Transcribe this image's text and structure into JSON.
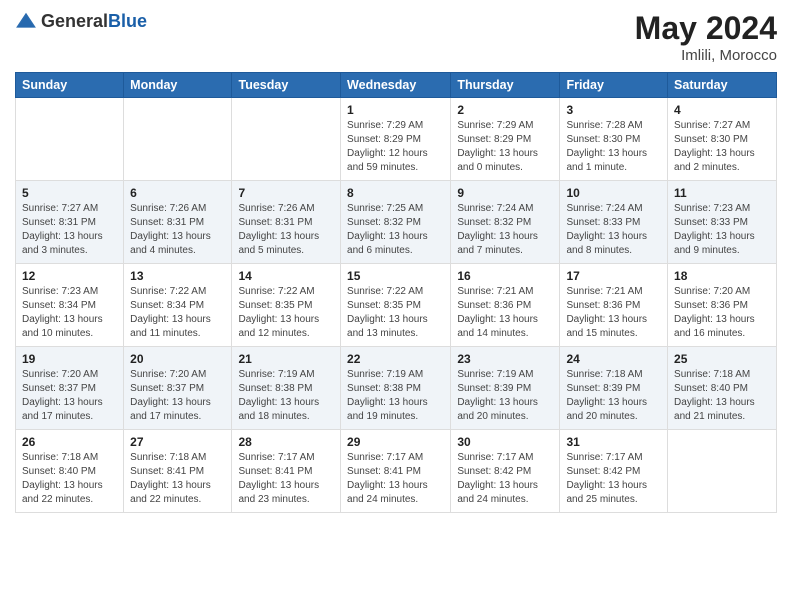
{
  "header": {
    "logo_general": "General",
    "logo_blue": "Blue",
    "month_year": "May 2024",
    "location": "Imlili, Morocco"
  },
  "days_of_week": [
    "Sunday",
    "Monday",
    "Tuesday",
    "Wednesday",
    "Thursday",
    "Friday",
    "Saturday"
  ],
  "weeks": [
    [
      {
        "day": "",
        "info": ""
      },
      {
        "day": "",
        "info": ""
      },
      {
        "day": "",
        "info": ""
      },
      {
        "day": "1",
        "info": "Sunrise: 7:29 AM\nSunset: 8:29 PM\nDaylight: 12 hours\nand 59 minutes."
      },
      {
        "day": "2",
        "info": "Sunrise: 7:29 AM\nSunset: 8:29 PM\nDaylight: 13 hours\nand 0 minutes."
      },
      {
        "day": "3",
        "info": "Sunrise: 7:28 AM\nSunset: 8:30 PM\nDaylight: 13 hours\nand 1 minute."
      },
      {
        "day": "4",
        "info": "Sunrise: 7:27 AM\nSunset: 8:30 PM\nDaylight: 13 hours\nand 2 minutes."
      }
    ],
    [
      {
        "day": "5",
        "info": "Sunrise: 7:27 AM\nSunset: 8:31 PM\nDaylight: 13 hours\nand 3 minutes."
      },
      {
        "day": "6",
        "info": "Sunrise: 7:26 AM\nSunset: 8:31 PM\nDaylight: 13 hours\nand 4 minutes."
      },
      {
        "day": "7",
        "info": "Sunrise: 7:26 AM\nSunset: 8:31 PM\nDaylight: 13 hours\nand 5 minutes."
      },
      {
        "day": "8",
        "info": "Sunrise: 7:25 AM\nSunset: 8:32 PM\nDaylight: 13 hours\nand 6 minutes."
      },
      {
        "day": "9",
        "info": "Sunrise: 7:24 AM\nSunset: 8:32 PM\nDaylight: 13 hours\nand 7 minutes."
      },
      {
        "day": "10",
        "info": "Sunrise: 7:24 AM\nSunset: 8:33 PM\nDaylight: 13 hours\nand 8 minutes."
      },
      {
        "day": "11",
        "info": "Sunrise: 7:23 AM\nSunset: 8:33 PM\nDaylight: 13 hours\nand 9 minutes."
      }
    ],
    [
      {
        "day": "12",
        "info": "Sunrise: 7:23 AM\nSunset: 8:34 PM\nDaylight: 13 hours\nand 10 minutes."
      },
      {
        "day": "13",
        "info": "Sunrise: 7:22 AM\nSunset: 8:34 PM\nDaylight: 13 hours\nand 11 minutes."
      },
      {
        "day": "14",
        "info": "Sunrise: 7:22 AM\nSunset: 8:35 PM\nDaylight: 13 hours\nand 12 minutes."
      },
      {
        "day": "15",
        "info": "Sunrise: 7:22 AM\nSunset: 8:35 PM\nDaylight: 13 hours\nand 13 minutes."
      },
      {
        "day": "16",
        "info": "Sunrise: 7:21 AM\nSunset: 8:36 PM\nDaylight: 13 hours\nand 14 minutes."
      },
      {
        "day": "17",
        "info": "Sunrise: 7:21 AM\nSunset: 8:36 PM\nDaylight: 13 hours\nand 15 minutes."
      },
      {
        "day": "18",
        "info": "Sunrise: 7:20 AM\nSunset: 8:36 PM\nDaylight: 13 hours\nand 16 minutes."
      }
    ],
    [
      {
        "day": "19",
        "info": "Sunrise: 7:20 AM\nSunset: 8:37 PM\nDaylight: 13 hours\nand 17 minutes."
      },
      {
        "day": "20",
        "info": "Sunrise: 7:20 AM\nSunset: 8:37 PM\nDaylight: 13 hours\nand 17 minutes."
      },
      {
        "day": "21",
        "info": "Sunrise: 7:19 AM\nSunset: 8:38 PM\nDaylight: 13 hours\nand 18 minutes."
      },
      {
        "day": "22",
        "info": "Sunrise: 7:19 AM\nSunset: 8:38 PM\nDaylight: 13 hours\nand 19 minutes."
      },
      {
        "day": "23",
        "info": "Sunrise: 7:19 AM\nSunset: 8:39 PM\nDaylight: 13 hours\nand 20 minutes."
      },
      {
        "day": "24",
        "info": "Sunrise: 7:18 AM\nSunset: 8:39 PM\nDaylight: 13 hours\nand 20 minutes."
      },
      {
        "day": "25",
        "info": "Sunrise: 7:18 AM\nSunset: 8:40 PM\nDaylight: 13 hours\nand 21 minutes."
      }
    ],
    [
      {
        "day": "26",
        "info": "Sunrise: 7:18 AM\nSunset: 8:40 PM\nDaylight: 13 hours\nand 22 minutes."
      },
      {
        "day": "27",
        "info": "Sunrise: 7:18 AM\nSunset: 8:41 PM\nDaylight: 13 hours\nand 22 minutes."
      },
      {
        "day": "28",
        "info": "Sunrise: 7:17 AM\nSunset: 8:41 PM\nDaylight: 13 hours\nand 23 minutes."
      },
      {
        "day": "29",
        "info": "Sunrise: 7:17 AM\nSunset: 8:41 PM\nDaylight: 13 hours\nand 24 minutes."
      },
      {
        "day": "30",
        "info": "Sunrise: 7:17 AM\nSunset: 8:42 PM\nDaylight: 13 hours\nand 24 minutes."
      },
      {
        "day": "31",
        "info": "Sunrise: 7:17 AM\nSunset: 8:42 PM\nDaylight: 13 hours\nand 25 minutes."
      },
      {
        "day": "",
        "info": ""
      }
    ]
  ]
}
